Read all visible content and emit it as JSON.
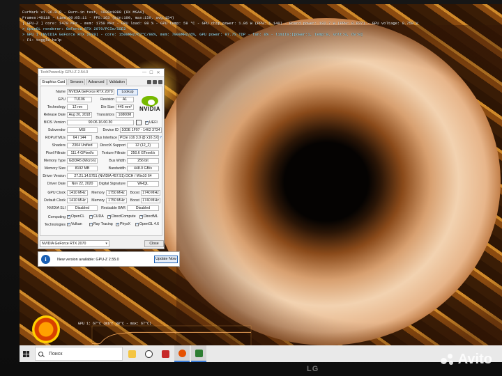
{
  "furmark_overlay": {
    "lines": [
      {
        "text": "FurMark v1.36.0.0 - Burn-in test, 1920x1080 (8X MSAA)",
        "kind": "white"
      },
      {
        "text": "Frames:40118 - time:00:05:11 - FPS:163 (min:100, max:159, avg:154)",
        "kind": "white"
      },
      {
        "text": "[ GPU-Z ] core: 1470 MHz - mem: 1750 MHz - GPU load: 98 % - GPU temp: 58 °C - GPU chip power: 1.86 W (PPW: 1.140) - Board power: 192.7 W (PPW: 0.837) - GPU voltage: 0.750 V",
        "kind": "white"
      },
      {
        "text": "> OpenGL renderer: GeForce RTX 2070/PCIe/SSE2",
        "kind": "cyan"
      },
      {
        "text": "> GPU 1 (NVIDIA GeForce RTX 2070) - core: 1500MHz/67°C/98%, mem: 7000MHz/6%, GPU power: 97.7% TDP - fan: 0% - limits:[power:1, temp:0, volt:0, OV:0]",
        "kind": "cyan"
      },
      {
        "text": "- F1: toggle help",
        "kind": "white"
      }
    ],
    "graph_label": "GPU 1: 67°C (min: 38°C - max: 67°C)"
  },
  "gpuz": {
    "title": "TechPowerUp GPU-Z 2.54.0",
    "window_buttons": [
      "—",
      "☐",
      "✕"
    ],
    "tabs": [
      "Graphics Card",
      "Sensors",
      "Advanced",
      "Validation"
    ],
    "lookup_label": "Lookup",
    "uefi_label": "UEFI",
    "vendor_logo": "NVIDIA",
    "fields": {
      "name": {
        "label": "Name",
        "value": "NVIDIA GeForce RTX 2070"
      },
      "gpu": {
        "label": "GPU",
        "value": "TU106"
      },
      "revision": {
        "label": "Revision",
        "value": "A1"
      },
      "technology": {
        "label": "Technology",
        "value": "12 nm"
      },
      "die_size": {
        "label": "Die Size",
        "value": "445 mm²"
      },
      "release_date": {
        "label": "Release Date",
        "value": "Aug 20, 2018"
      },
      "transistors": {
        "label": "Transistors",
        "value": "10800M"
      },
      "bios_version": {
        "label": "BIOS Version",
        "value": "90.06.16.00.30"
      },
      "subvendor": {
        "label": "Subvendor",
        "value": "MSI"
      },
      "device_id": {
        "label": "Device ID",
        "value": "10DE 1F07 - 1462 3734"
      },
      "rops_tmus": {
        "label": "ROPs/TMUs",
        "value": "64 / 144"
      },
      "bus_interface": {
        "label": "Bus Interface",
        "value": "PCIe x16 3.0 @ x16 3.0"
      },
      "shaders": {
        "label": "Shaders",
        "value": "2304 Unified"
      },
      "directx": {
        "label": "DirectX Support",
        "value": "12 (12_2)"
      },
      "pixel_fillrate": {
        "label": "Pixel Fillrate",
        "value": "111.4 GPixel/s"
      },
      "texture_fillrate": {
        "label": "Texture Fillrate",
        "value": "250.6 GTexel/s"
      },
      "memory_type": {
        "label": "Memory Type",
        "value": "GDDR6 (Micron)"
      },
      "bus_width": {
        "label": "Bus Width",
        "value": "256 bit"
      },
      "memory_size": {
        "label": "Memory Size",
        "value": "8192 MB"
      },
      "bandwidth": {
        "label": "Bandwidth",
        "value": "448.0 GB/s"
      },
      "driver_version": {
        "label": "Driver Version",
        "value": "27.21.14.5751 (NVIDIA 457.51) DCH / Win10 64"
      },
      "driver_date": {
        "label": "Driver Date",
        "value": "Nov 22, 2020"
      },
      "digital_signature": {
        "label": "Digital Signature",
        "value": "WHQL"
      },
      "gpu_clock": {
        "label": "GPU Clock",
        "value": "1410 MHz"
      },
      "gpu_memory": {
        "label": "Memory",
        "value": "1750 MHz"
      },
      "gpu_boost": {
        "label": "Boost",
        "value": "1740 MHz"
      },
      "default_clock": {
        "label": "Default Clock",
        "value": "1410 MHz"
      },
      "default_memory": {
        "label": "Memory",
        "value": "1750 MHz"
      },
      "default_boost": {
        "label": "Boost",
        "value": "1740 MHz"
      },
      "nvidia_sli": {
        "label": "NVIDIA SLI",
        "value": "Disabled"
      },
      "resizable_bar": {
        "label": "Resizable BAR",
        "value": "Disabled"
      }
    },
    "computing": {
      "label": "Computing",
      "items": [
        "OpenCL",
        "CUDA",
        "DirectCompute",
        "DirectML"
      ]
    },
    "technologies": {
      "label": "Technologies",
      "items": [
        "Vulkan",
        "Ray Tracing",
        "PhysX",
        "OpenGL 4.6"
      ]
    },
    "selected_gpu": "NVIDIA GeForce RTX 2070",
    "close_label": "Close"
  },
  "update_notice": {
    "icon": "i",
    "message": "New version available: GPU-Z 2.55.0",
    "button_label": "Update Now"
  },
  "taskbar": {
    "search_placeholder": "Поиск",
    "apps": [
      "file-explorer",
      "yandex-browser",
      "app-red",
      "furmark",
      "gpuz"
    ]
  },
  "bezel": {
    "brand": "LG",
    "watermark": "Avito"
  },
  "colors": {
    "nvidia_green": "#76b900",
    "overlay_cyan": "#9ee8ff",
    "graph_line": "#ffb060",
    "accent_blue": "#1a5fb4"
  },
  "graph": {
    "min_temp_c": 38,
    "max_temp_c": 67,
    "current_temp_c": 67
  }
}
